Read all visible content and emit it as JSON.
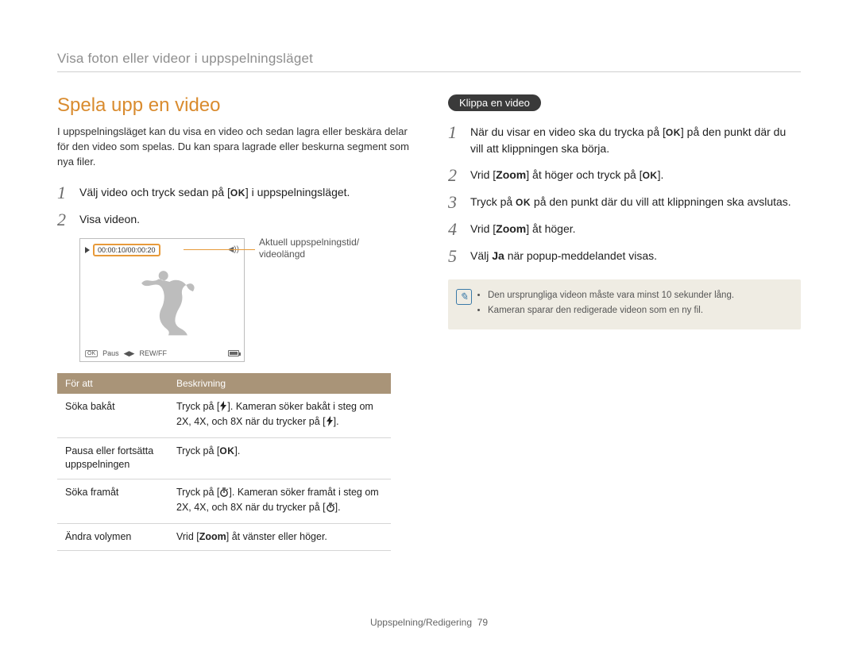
{
  "breadcrumb": "Visa foton eller videor i uppspelningsläget",
  "left": {
    "heading": "Spela upp en video",
    "intro": "I uppspelningsläget kan du visa en video och sedan lagra eller beskära delar för den video som spelas. Du kan spara lagrade eller beskurna segment som nya filer.",
    "step1_a": "Välj video och tryck sedan på [",
    "step1_ok": "OK",
    "step1_b": "] i uppspelningsläget.",
    "step2": "Visa videon.",
    "screen": {
      "time": "00:00:10/00:00:20",
      "pause": "Paus",
      "rewff": "REW/FF",
      "ok": "OK"
    },
    "annotation": "Aktuell uppspelningstid/\nvideolängd",
    "table": {
      "head_a": "För att",
      "head_b": "Beskrivning",
      "rows": [
        {
          "a": "Söka bakåt",
          "b_pre": "Tryck på [",
          "b_mid": "]. Kameran söker bakåt i steg om 2X, 4X, och 8X när du trycker på [",
          "b_post": "].",
          "icon": "flash"
        },
        {
          "a": "Pausa eller fortsätta uppspelningen",
          "b_pre": "Tryck på [",
          "b_ok": "OK",
          "b_post": "]."
        },
        {
          "a": "Söka framåt",
          "b_pre": "Tryck på [",
          "b_mid": "]. Kameran söker framåt i steg om 2X, 4X, och 8X när du trycker på [",
          "b_post": "].",
          "icon": "timer"
        },
        {
          "a": "Ändra volymen",
          "b_plain_pre": "Vrid [",
          "b_zoom": "Zoom",
          "b_plain_post": "] åt vänster eller höger."
        }
      ]
    }
  },
  "right": {
    "pill": "Klippa en video",
    "step1_a": "När du visar en video ska du trycka på [",
    "step1_ok": "OK",
    "step1_b": "] på den punkt där du vill att klippningen ska börja.",
    "step2_a": "Vrid [",
    "step2_zoom": "Zoom",
    "step2_b": "] åt höger och tryck på [",
    "step2_ok": "OK",
    "step2_c": "].",
    "step3_a": "Tryck på ",
    "step3_ok": "OK",
    "step3_b": " på den punkt där du vill att klippningen ska avslutas.",
    "step4_a": "Vrid [",
    "step4_zoom": "Zoom",
    "step4_b": "] åt höger.",
    "step5_a": "Välj ",
    "step5_ja": "Ja",
    "step5_b": " när popup-meddelandet visas.",
    "notes": [
      "Den ursprungliga videon måste vara minst 10 sekunder lång.",
      "Kameran sparar den redigerade videon som en ny fil."
    ]
  },
  "footer": {
    "section": "Uppspelning/Redigering",
    "page": "79"
  }
}
